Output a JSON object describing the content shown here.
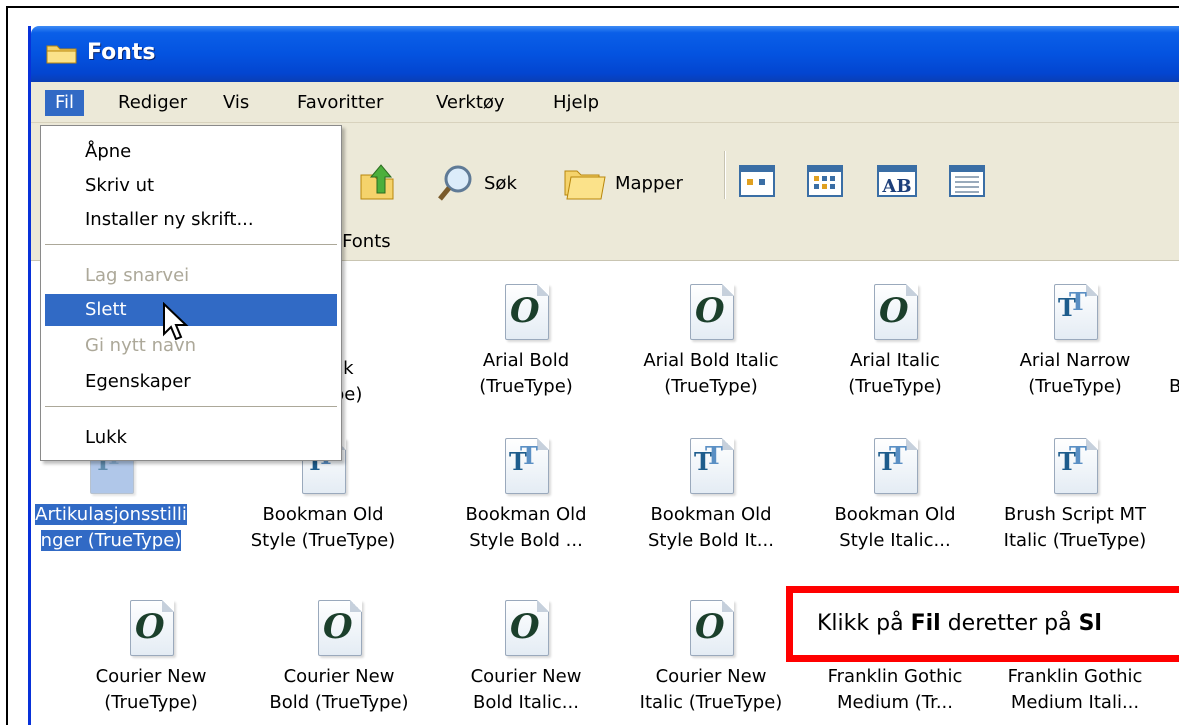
{
  "window": {
    "title": "Fonts",
    "address": "\\Fonts"
  },
  "menubar": [
    "Fil",
    "Rediger",
    "Vis",
    "Favoritter",
    "Verktøy",
    "Hjelp"
  ],
  "toolbar": {
    "search_label": "Søk",
    "folders_label": "Mapper"
  },
  "file_menu": {
    "items": [
      {
        "label": "Åpne",
        "state": "normal"
      },
      {
        "label": "Skriv ut",
        "state": "normal"
      },
      {
        "label": "Installer ny skrift...",
        "state": "normal"
      },
      {
        "label": "Lag snarvei",
        "state": "disabled"
      },
      {
        "label": "Slett",
        "state": "highlighted"
      },
      {
        "label": "Gi nytt navn",
        "state": "disabled"
      },
      {
        "label": "Egenskaper",
        "state": "normal"
      },
      {
        "label": "Lukk",
        "state": "normal"
      }
    ]
  },
  "fonts": {
    "row1": [
      {
        "line1": "...ack",
        "line2": "...ype)",
        "icon": "opentype-icon"
      },
      {
        "line1": "Arial Bold",
        "line2": "(TrueType)",
        "icon": "opentype-icon"
      },
      {
        "line1": "Arial Bold Italic",
        "line2": "(TrueType)",
        "icon": "opentype-icon"
      },
      {
        "line1": "Arial Italic",
        "line2": "(TrueType)",
        "icon": "opentype-icon"
      },
      {
        "line1": "Arial Narrow",
        "line2": "(TrueType)",
        "icon": "truetype-icon"
      },
      {
        "line1": "B",
        "line2": "",
        "icon": ""
      }
    ],
    "row2": [
      {
        "line1": "Artikulasjonsstilli",
        "line2": "nger (TrueType)",
        "icon": "truetype-icon",
        "selected": true
      },
      {
        "line1": "Bookman Old",
        "line2": "Style (TrueType)",
        "icon": "truetype-icon"
      },
      {
        "line1": "Bookman Old",
        "line2": "Style Bold ...",
        "icon": "truetype-icon"
      },
      {
        "line1": "Bookman Old",
        "line2": "Style Bold It...",
        "icon": "truetype-icon"
      },
      {
        "line1": "Bookman Old",
        "line2": "Style Italic...",
        "icon": "truetype-icon"
      },
      {
        "line1": "Brush Script MT",
        "line2": "Italic (TrueType)",
        "icon": "truetype-icon"
      }
    ],
    "row3": [
      {
        "line1": "Courier New",
        "line2": "(TrueType)",
        "icon": "opentype-icon"
      },
      {
        "line1": "Courier New",
        "line2": "Bold (TrueType)",
        "icon": "opentype-icon"
      },
      {
        "line1": "Courier New",
        "line2": "Bold Italic...",
        "icon": "opentype-icon"
      },
      {
        "line1": "Courier New",
        "line2": "Italic (TrueType)",
        "icon": "opentype-icon"
      },
      {
        "line1": "Franklin Gothic",
        "line2": "Medium (Tr...",
        "icon": ""
      },
      {
        "line1": "Franklin Gothic",
        "line2": "Medium Itali...",
        "icon": ""
      }
    ]
  },
  "callout": {
    "pre": "Klikk på ",
    "bold1": "Fil",
    "mid": " deretter på ",
    "bold2": "Sl"
  }
}
